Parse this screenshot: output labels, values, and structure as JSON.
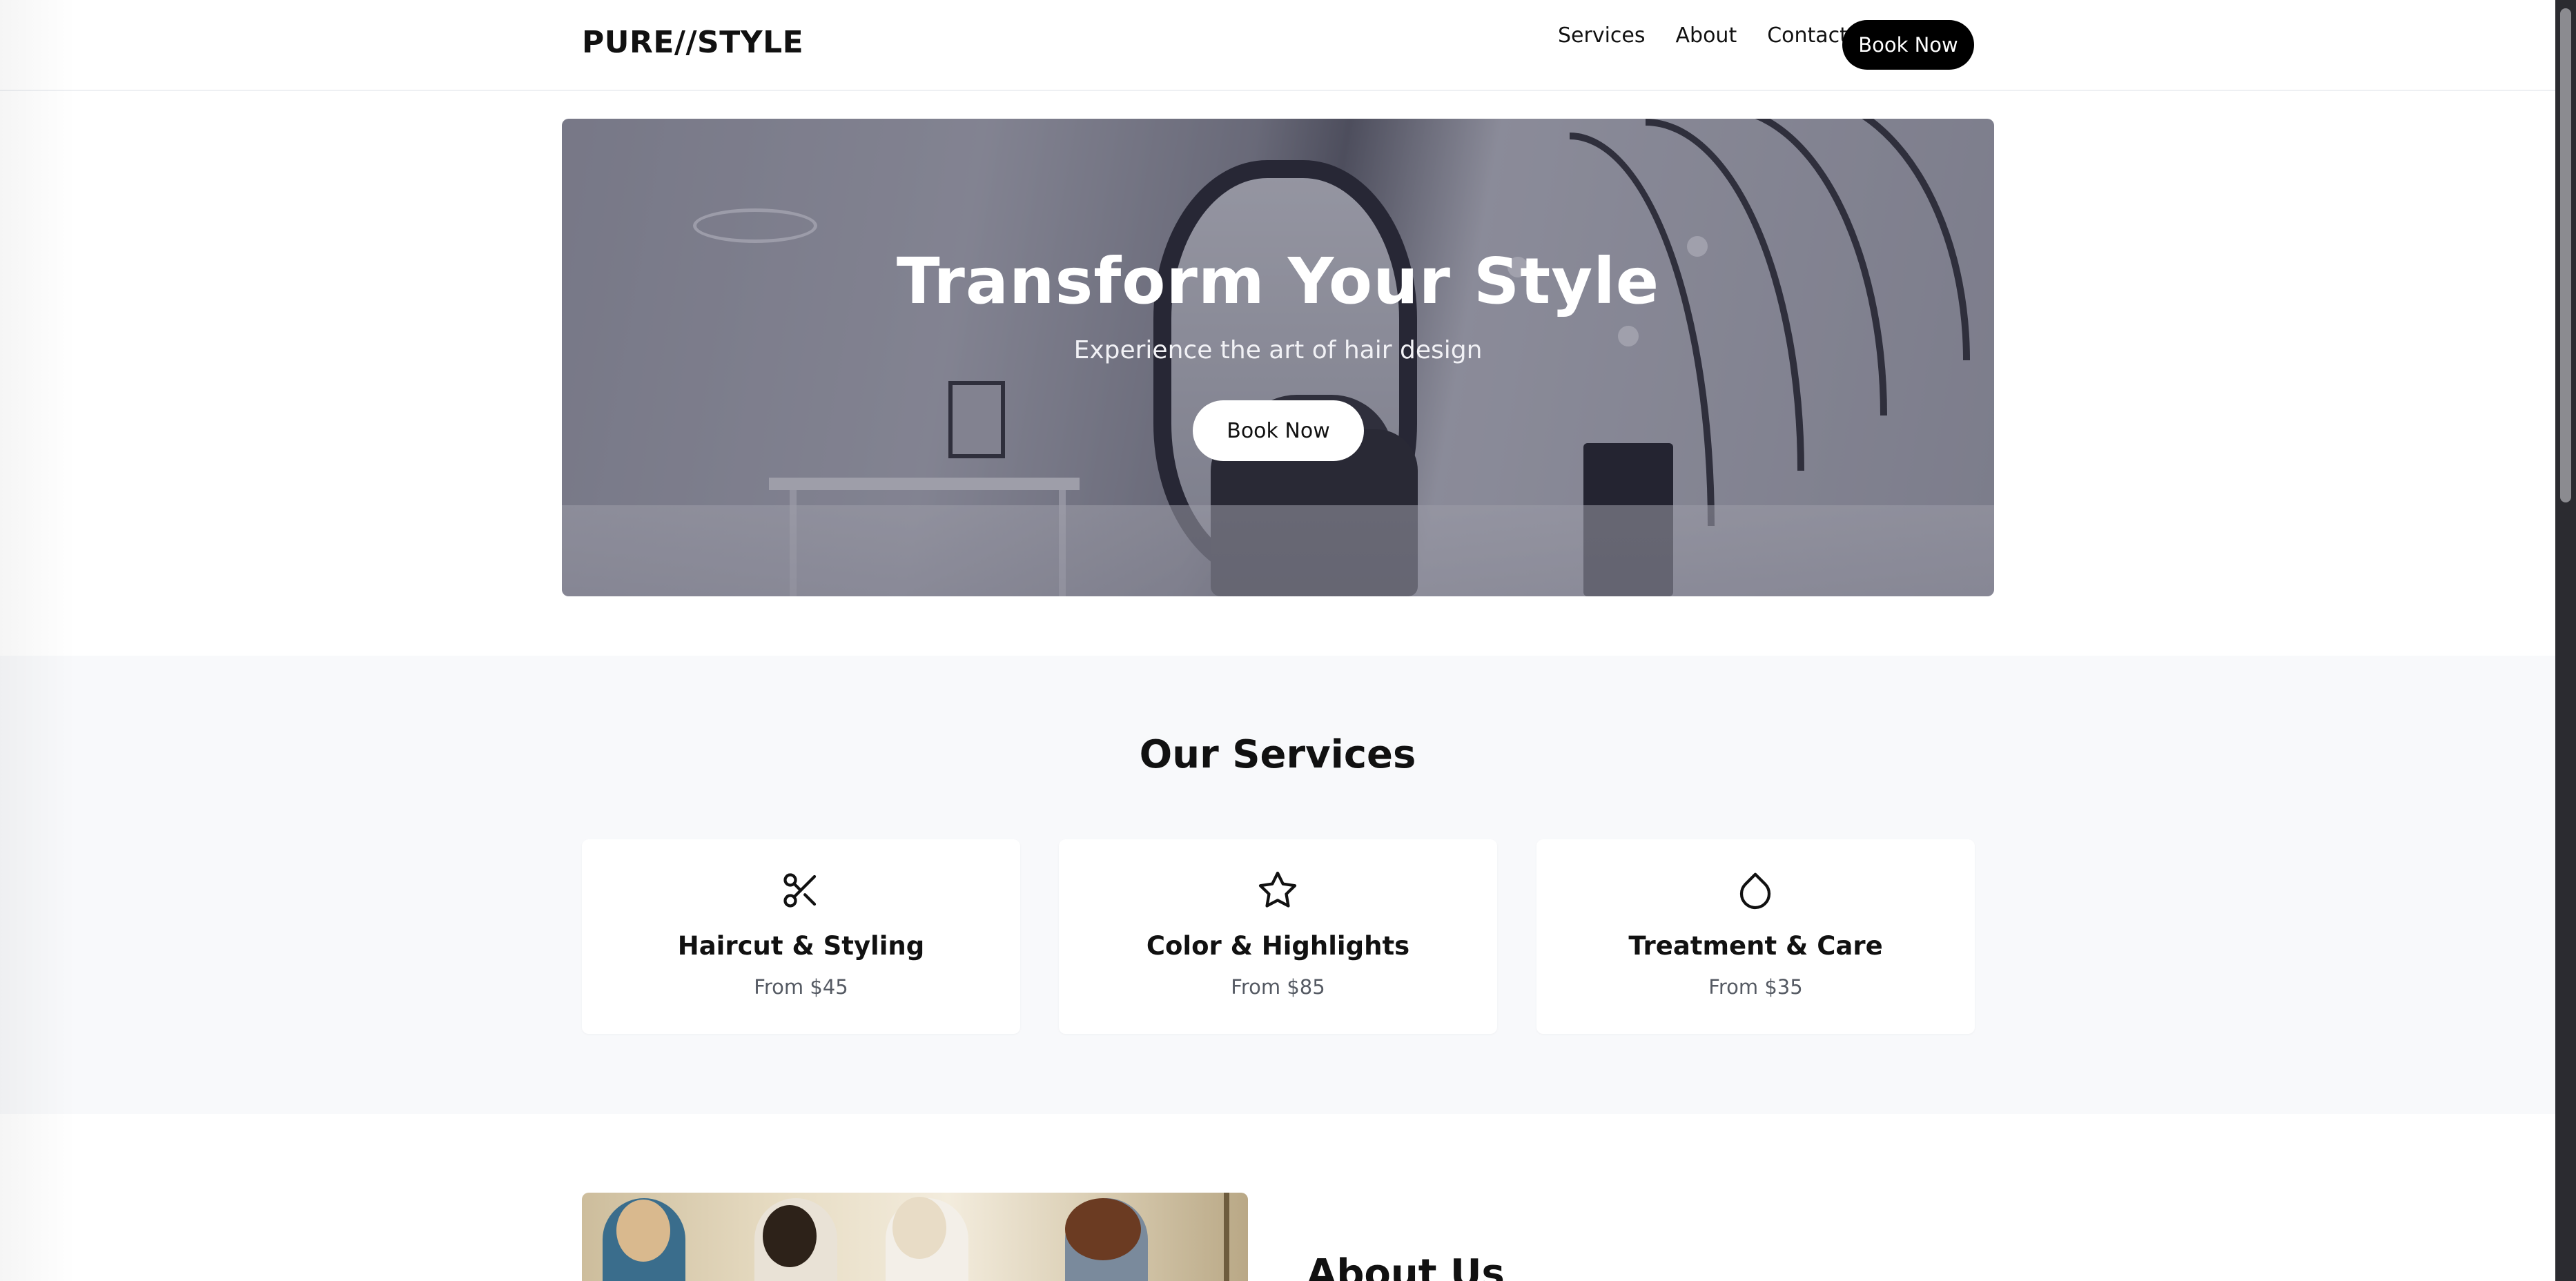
{
  "navbar": {
    "logo": "PURE//STYLE",
    "links": [
      "Services",
      "About",
      "Contact"
    ],
    "book_label": "Book Now"
  },
  "hero": {
    "title": "Transform Your Style",
    "subtitle": "Experience the art of hair design",
    "book_label": "Book Now",
    "background_image": "salon interior with oval mirror and black styling chair"
  },
  "services": {
    "title": "Our Services",
    "items": [
      {
        "icon": "scissors-icon",
        "name": "Haircut & Styling",
        "price": "From $45"
      },
      {
        "icon": "star-icon",
        "name": "Color & Highlights",
        "price": "From $85"
      },
      {
        "icon": "droplet-icon",
        "name": "Treatment & Care",
        "price": "From $35"
      }
    ]
  },
  "about": {
    "title": "About Us",
    "image": "group of women smiling in a salon"
  },
  "colors": {
    "primary": "#000000",
    "background": "#ffffff",
    "section_background": "#f8f9fb",
    "muted_text": "#555a63"
  }
}
